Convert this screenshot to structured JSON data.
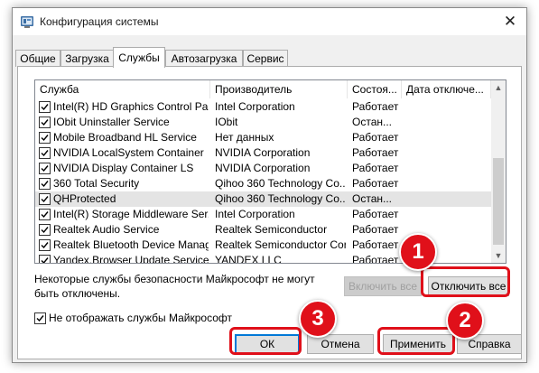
{
  "window": {
    "title": "Конфигурация системы",
    "close_glyph": "✕"
  },
  "tabs": [
    {
      "label": "Общие",
      "active": false
    },
    {
      "label": "Загрузка",
      "active": false
    },
    {
      "label": "Службы",
      "active": true
    },
    {
      "label": "Автозагрузка",
      "active": false
    },
    {
      "label": "Сервис",
      "active": false
    }
  ],
  "services_list": {
    "columns": [
      "Служба",
      "Производитель",
      "Состоя...",
      "Дата отключе..."
    ],
    "rows": [
      {
        "checked": true,
        "service": "Intel(R) HD Graphics Control Pa...",
        "manufacturer": "Intel Corporation",
        "status": "Работает",
        "date": "",
        "selected": false
      },
      {
        "checked": true,
        "service": "IObit Uninstaller Service",
        "manufacturer": "IObit",
        "status": "Остан...",
        "date": "",
        "selected": false
      },
      {
        "checked": true,
        "service": "Mobile Broadband HL Service",
        "manufacturer": "Нет данных",
        "status": "Работает",
        "date": "",
        "selected": false
      },
      {
        "checked": true,
        "service": "NVIDIA LocalSystem Container",
        "manufacturer": "NVIDIA Corporation",
        "status": "Работает",
        "date": "",
        "selected": false
      },
      {
        "checked": true,
        "service": "NVIDIA Display Container LS",
        "manufacturer": "NVIDIA Corporation",
        "status": "Работает",
        "date": "",
        "selected": false
      },
      {
        "checked": true,
        "service": "360 Total Security",
        "manufacturer": "Qihoo 360 Technology Co....",
        "status": "Работает",
        "date": "",
        "selected": false
      },
      {
        "checked": true,
        "service": "QHProtected",
        "manufacturer": "Qihoo 360 Technology Co....",
        "status": "Остан...",
        "date": "",
        "selected": true
      },
      {
        "checked": true,
        "service": "Intel(R) Storage Middleware Ser...",
        "manufacturer": "Intel Corporation",
        "status": "Работает",
        "date": "",
        "selected": false
      },
      {
        "checked": true,
        "service": "Realtek Audio Service",
        "manufacturer": "Realtek Semiconductor",
        "status": "Работает",
        "date": "",
        "selected": false
      },
      {
        "checked": true,
        "service": "Realtek Bluetooth Device Manag...",
        "manufacturer": "Realtek Semiconductor Corp.",
        "status": "Работает",
        "date": "",
        "selected": false
      },
      {
        "checked": true,
        "service": "Yandex.Browser Update Service",
        "manufacturer": "YANDEX LLC",
        "status": "Работает",
        "date": "",
        "selected": false
      }
    ],
    "scroll_up_glyph": "▲",
    "scroll_down_glyph": "▼"
  },
  "note": "Некоторые службы безопасности Майкрософт не могут быть отключены.",
  "buttons": {
    "enable_all": "Включить все",
    "disable_all": "Отключить все",
    "ok": "ОК",
    "cancel": "Отмена",
    "apply": "Применить",
    "help": "Справка"
  },
  "hide_microsoft": {
    "label": "Не отображать службы Майкрософт",
    "checked": true
  },
  "annotations": {
    "badge_1": "1",
    "badge_2": "2",
    "badge_3": "3",
    "highlight_color": "#e0101a"
  }
}
